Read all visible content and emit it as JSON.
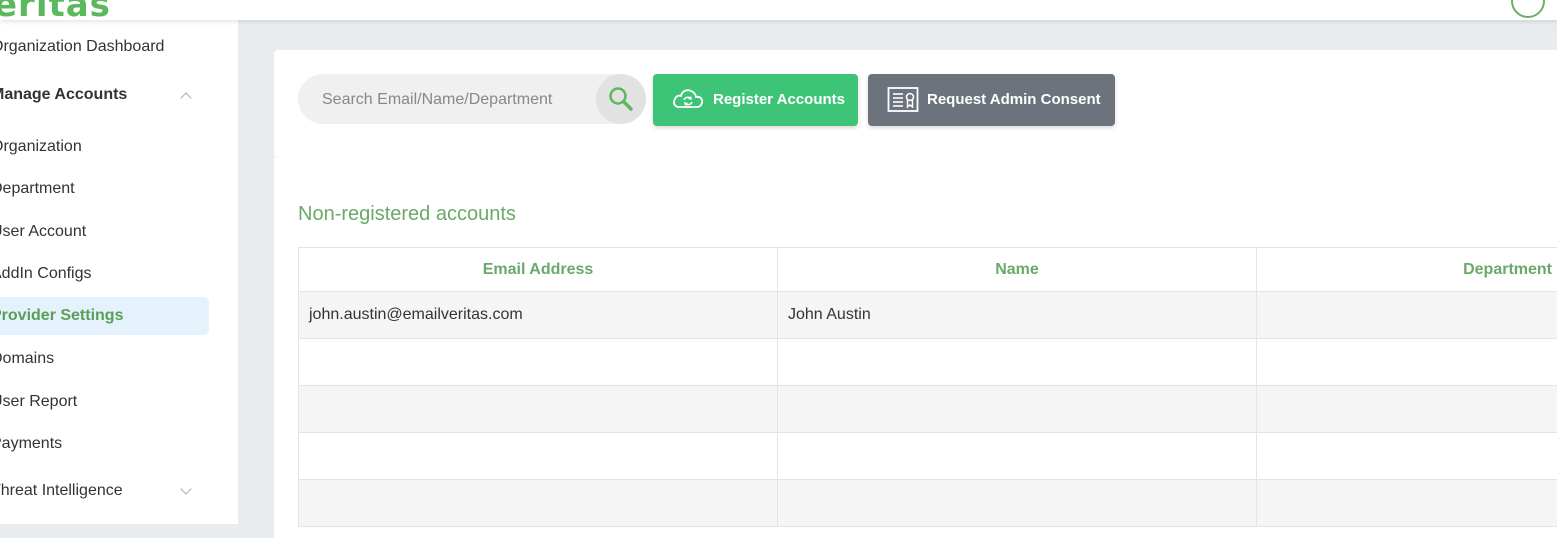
{
  "header": {
    "logo_text": "eritas"
  },
  "sidebar": {
    "items": [
      {
        "label": "Organization Dashboard"
      },
      {
        "label": "Manage Accounts"
      },
      {
        "label": "Organization"
      },
      {
        "label": "Department"
      },
      {
        "label": "User Account"
      },
      {
        "label": "AddIn Configs"
      },
      {
        "label": "Provider Settings"
      },
      {
        "label": "Domains"
      },
      {
        "label": "User Report"
      },
      {
        "label": "Payments"
      },
      {
        "label": "Threat Intelligence"
      }
    ],
    "active_item": "Provider Settings"
  },
  "toolbar": {
    "search_placeholder": "Search Email/Name/Department",
    "register_label": "Register Accounts",
    "consent_label": "Request Admin Consent"
  },
  "main": {
    "section_title": "Non-registered accounts",
    "columns": [
      "Email Address",
      "Name",
      "Department"
    ],
    "rows": [
      [
        "john.austin@emailveritas.com",
        "John Austin",
        ""
      ],
      [
        "",
        "",
        ""
      ],
      [
        "",
        "",
        ""
      ],
      [
        "",
        "",
        ""
      ],
      [
        "",
        "",
        ""
      ]
    ]
  },
  "colors": {
    "brand_green": "#5cb85c",
    "register_button": "#3ec477",
    "consent_button": "#6c737d",
    "active_nav_bg": "#e4f2fb"
  }
}
